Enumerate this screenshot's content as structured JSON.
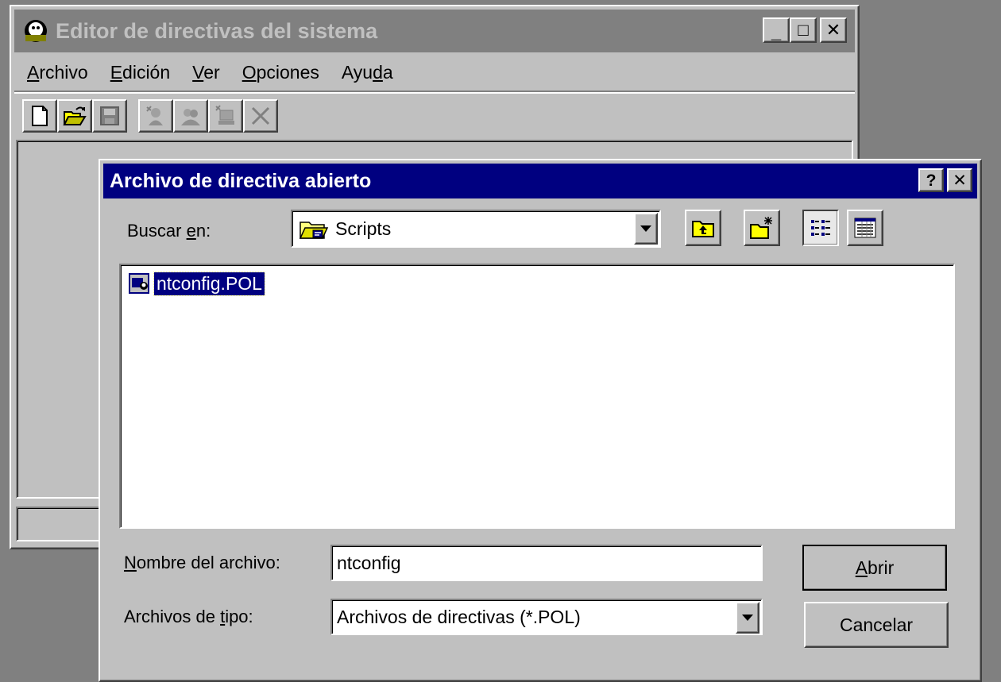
{
  "main_window": {
    "title": "Editor de directivas del sistema",
    "title_buttons": {
      "minimize": "_",
      "maximize": "□",
      "close": "✕"
    },
    "menu": [
      {
        "label": "Archivo",
        "underline_index": 0
      },
      {
        "label": "Edición",
        "underline_index": 0
      },
      {
        "label": "Ver",
        "underline_index": 0
      },
      {
        "label": "Opciones",
        "underline_index": 0
      },
      {
        "label": "Ayuda",
        "underline_index": 3
      }
    ],
    "toolbar_icons": [
      "new-icon",
      "open-icon",
      "save-icon",
      "add-user-icon",
      "add-group-icon",
      "add-computer-icon",
      "remove-icon"
    ]
  },
  "dialog": {
    "title": "Archivo de directiva abierto",
    "title_buttons": {
      "help": "?",
      "close": "✕"
    },
    "lookin_label": "Buscar en:",
    "lookin_value": "Scripts",
    "files": [
      {
        "name": "ntconfig.POL",
        "selected": true
      }
    ],
    "filename_label": "Nombre del archivo:",
    "filename_value": "ntconfig",
    "filetype_label": "Archivos de tipo:",
    "filetype_value": "Archivos de directivas (*.POL)",
    "open_label": "Abrir",
    "cancel_label": "Cancelar"
  },
  "colors": {
    "face": "#c0c0c0",
    "active_title": "#000080",
    "inactive_title": "#808080",
    "desktop": "#808080",
    "selection": "#000080"
  }
}
